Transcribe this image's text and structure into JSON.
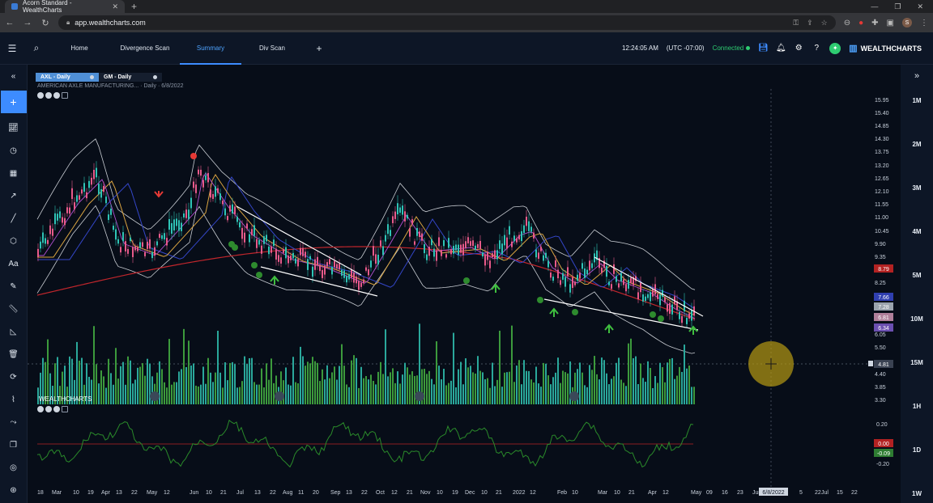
{
  "browser": {
    "tab_title": "Acorn Standard - WealthCharts",
    "url": "app.wealthcharts.com"
  },
  "nav": {
    "tabs": [
      "Home",
      "Divergence Scan",
      "Summary",
      "Div Scan"
    ],
    "active": "Summary"
  },
  "header": {
    "time": "12:24:05 AM",
    "timezone": "(UTC -07:00)",
    "status": "Connected",
    "brand": "WEALTHCHARTS"
  },
  "chart": {
    "symbol_tabs": [
      {
        "label": "AXL - Daily",
        "active": true
      },
      {
        "label": "GM - Daily",
        "active": false
      }
    ],
    "description": "AMERICAN AXLE MANUFACTURING...  · Daily · 6/8/2022",
    "watermark": "WEALTHCHARTS",
    "price_ticks": [
      "15.95",
      "15.40",
      "14.85",
      "14.30",
      "13.75",
      "13.20",
      "12.65",
      "12.10",
      "11.55",
      "11.00",
      "10.45",
      "9.90",
      "9.35",
      "8.25",
      "6.05",
      "5.50",
      "4.40",
      "3.85",
      "3.30"
    ],
    "badges": [
      {
        "value": "8.79",
        "color": "#b22222"
      },
      {
        "value": "7.66",
        "color": "#2f3fb0"
      },
      {
        "value": "7.28",
        "color": "#9aa3ad"
      },
      {
        "value": "6.81",
        "color": "#b07f9a"
      },
      {
        "value": "6.34",
        "color": "#6b4fb0"
      },
      {
        "value": "4.81",
        "color": "#3a4252"
      }
    ],
    "osc_ticks": [
      "0.20",
      "-0.20"
    ],
    "osc_badges": [
      {
        "value": "0.00",
        "color": "#b22222"
      },
      {
        "value": "-0.09",
        "color": "#2e7d32"
      }
    ],
    "date_ticks": [
      "18",
      "Mar",
      "10",
      "19",
      "Apr",
      "13",
      "22",
      "May",
      "12",
      "Jun",
      "10",
      "21",
      "Jul",
      "13",
      "22",
      "Aug",
      "11",
      "20",
      "Sep",
      "13",
      "22",
      "Oct",
      "12",
      "21",
      "Nov",
      "10",
      "19",
      "Dec",
      "10",
      "21",
      "2022",
      "12",
      "Feb",
      "10",
      "Mar",
      "10",
      "21",
      "Apr",
      "12",
      "May",
      "09",
      "16",
      "23",
      "Jun",
      "6/8/2022",
      "5",
      "22",
      "Jul",
      "15",
      "22"
    ],
    "crosshair_date": "6/8/2022",
    "crosshair_price": "4.81"
  },
  "right_timeframes": [
    "1M",
    "2M",
    "3M",
    "4M",
    "5M",
    "10M",
    "15M",
    "1H",
    "1D",
    "1W"
  ],
  "left_tools": [
    "collapse",
    "add",
    "indicators",
    "clock",
    "calendar",
    "trend",
    "line",
    "shapes",
    "text",
    "pencil",
    "ruler",
    "measure",
    "trash",
    "refresh",
    "chart-type",
    "connect",
    "layers",
    "settings",
    "share"
  ]
}
